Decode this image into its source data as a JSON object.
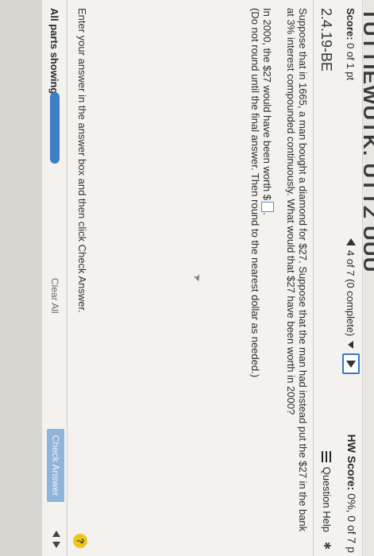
{
  "header": {
    "hw_title_fragment": "TUTTIEWUTK. UTTZ UUU",
    "score_label": "Score:",
    "score_value": "0 of 1 pt",
    "progress_text": "4 of 7 (0 complete)",
    "hw_score_label": "HW Score:",
    "hw_score_value": "0%, 0 of 7 p"
  },
  "question_bar": {
    "id": "2.4.19-BE",
    "help_label": "Question Help"
  },
  "question": {
    "prompt": "Suppose that in 1665, a man bought a diamond for $27. Suppose that the man had instead put the $27 in the bank at 3% interest compounded continuously. What would that $27 have been worth in 2000?",
    "answer_prefix": "In 2000, the $27 would have been worth $",
    "answer_suffix": ".",
    "instruction": "(Do not round until the final answer. Then round to the nearest dollar as needed.)"
  },
  "footer_bar": {
    "enter_message": "Enter your answer in the answer box and then click Check Answer.",
    "parts_label": "All parts showing",
    "progress_fraction": 0.0,
    "clear_all_label": "Clear All",
    "check_answer_label": "Check Answer",
    "help_glyph": "?"
  },
  "colors": {
    "accent": "#3d7fc7",
    "check_button": "#8fb4d9",
    "help_yellow": "#f0c419"
  }
}
